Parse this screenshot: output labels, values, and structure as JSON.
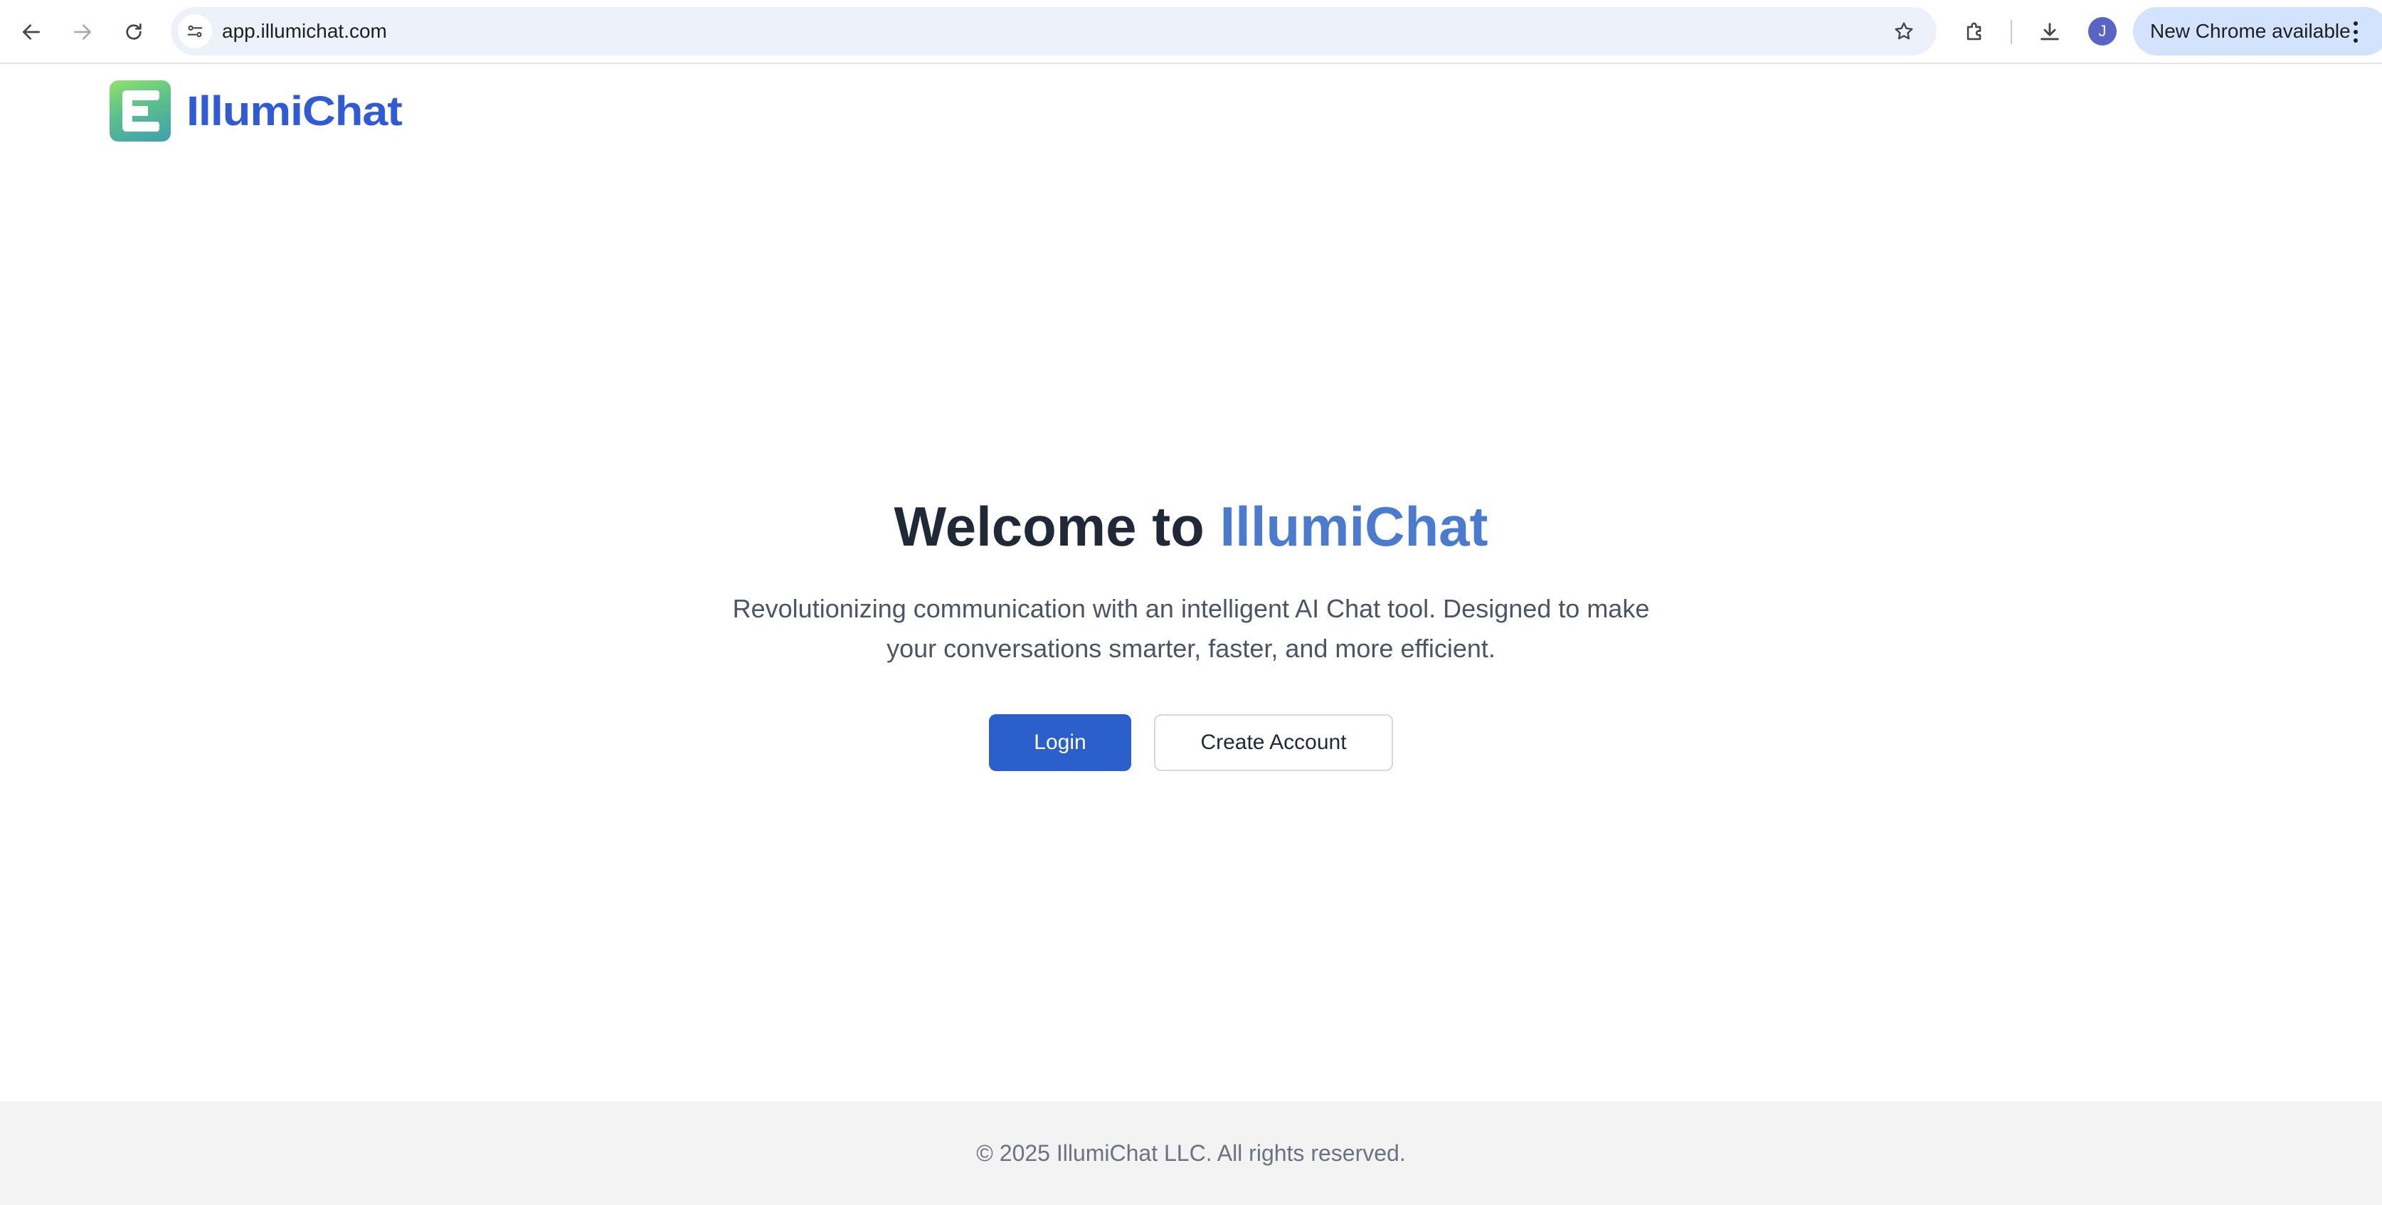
{
  "browser": {
    "url": "app.illumichat.com",
    "profile_initial": "J",
    "update_label": "New Chrome available",
    "icons": {
      "back": "arrow-left-icon",
      "forward": "arrow-right-icon",
      "reload": "reload-icon",
      "site_info": "site-settings-icon",
      "bookmark": "star-icon",
      "extensions": "puzzle-icon",
      "downloads": "download-icon",
      "menu": "kebab-menu-icon"
    }
  },
  "header": {
    "brand_name": "IllumiChat"
  },
  "hero": {
    "title_prefix": "Welcome to ",
    "title_accent": "IllumiChat",
    "subtitle": "Revolutionizing communication with an intelligent AI Chat tool. Designed to make your conversations smarter, faster, and more efficient.",
    "login_label": "Login",
    "create_account_label": "Create Account"
  },
  "footer": {
    "copyright": "© 2025 IllumiChat LLC. All rights reserved."
  },
  "colors": {
    "brand_blue": "#2f5bd8",
    "accent_blue": "#4a7bd0",
    "primary_button": "#2b5fcb",
    "omnibox_bg": "#edf2fa",
    "footer_bg": "#f3f3f3"
  }
}
